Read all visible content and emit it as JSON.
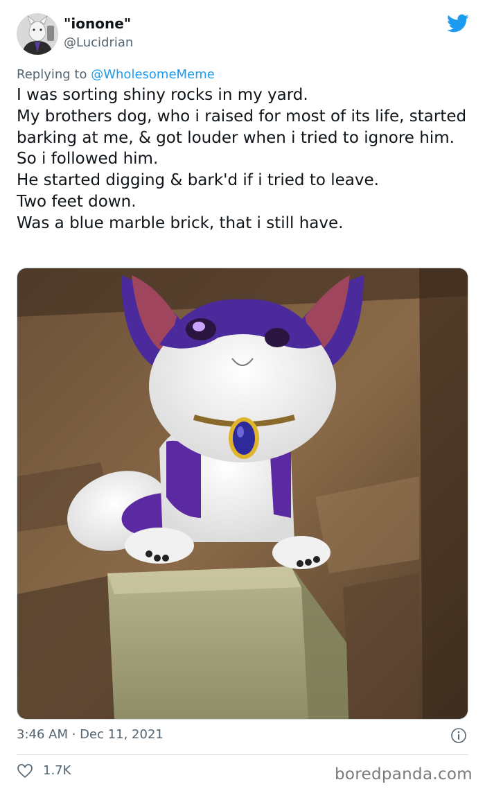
{
  "tweet": {
    "display_name": "\"ionone\"",
    "handle": "@Lucidrian",
    "reply_prefix": "Replying to",
    "reply_to": "@WholesomeMeme",
    "lines": [
      "I was sorting shiny rocks in my yard.",
      "My brothers dog, who i raised for most of its life, started barking at me, & got louder when i tried to ignore him.",
      "So i followed him.",
      "He started digging & bark'd if i tried to leave.",
      "Two feet down.",
      "Was a blue marble brick, that i still have."
    ],
    "timestamp": "3:46 AM · Dec 11, 2021",
    "likes": "1.7K"
  },
  "icons": {
    "brand": "twitter-bird-icon",
    "info": "info-icon",
    "like": "heart-icon"
  },
  "watermark": "boredpanda.com",
  "colors": {
    "twitter_blue": "#1d9bf0",
    "text": "#0f1419",
    "secondary": "#536471"
  }
}
